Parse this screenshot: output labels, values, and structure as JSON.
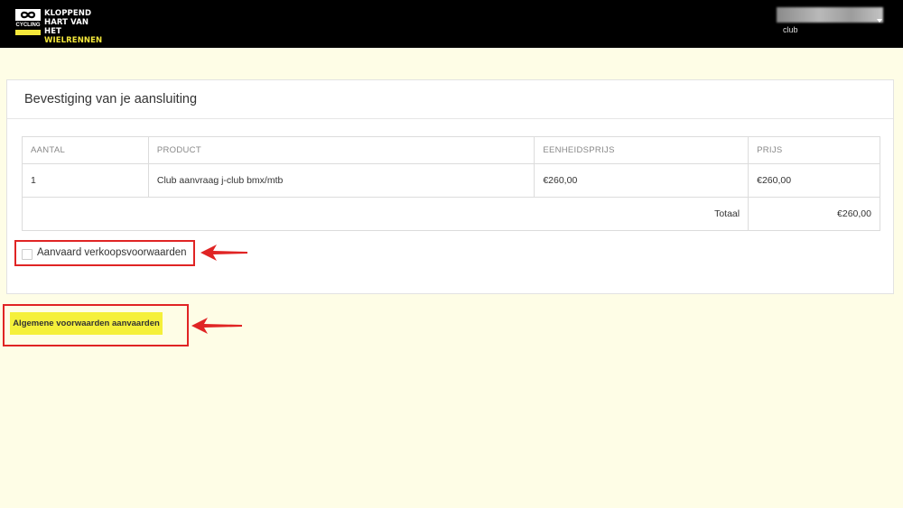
{
  "header": {
    "logo": {
      "badge_text": "CYCLING",
      "line1": "KLOPPEND",
      "line2": "HART VAN HET",
      "line3": "WIELRENNEN"
    },
    "user": {
      "role": "club"
    }
  },
  "panel": {
    "title": "Bevestiging van je aansluiting",
    "table": {
      "headers": [
        "AANTAL",
        "PRODUCT",
        "EENHEIDSPRIJS",
        "PRIJS"
      ],
      "rows": [
        [
          "1",
          "Club aanvraag j-club bmx/mtb",
          "€260,00",
          "€260,00"
        ]
      ],
      "total_label": "Totaal",
      "total_value": "€260,00"
    },
    "accept_checkbox_label": "Aanvaard verkoopsvoorwaarden",
    "accept_checked": false
  },
  "actions": {
    "accept_button_label": "Algemene voorwaarden aanvaarden"
  },
  "colors": {
    "header_bg": "#000000",
    "page_bg": "#fefde6",
    "accent_yellow": "#f5f03a",
    "annotation_red": "#e02424"
  },
  "icons": [
    "infinity-logo-icon",
    "chevron-down-icon",
    "red-arrow-icon"
  ]
}
